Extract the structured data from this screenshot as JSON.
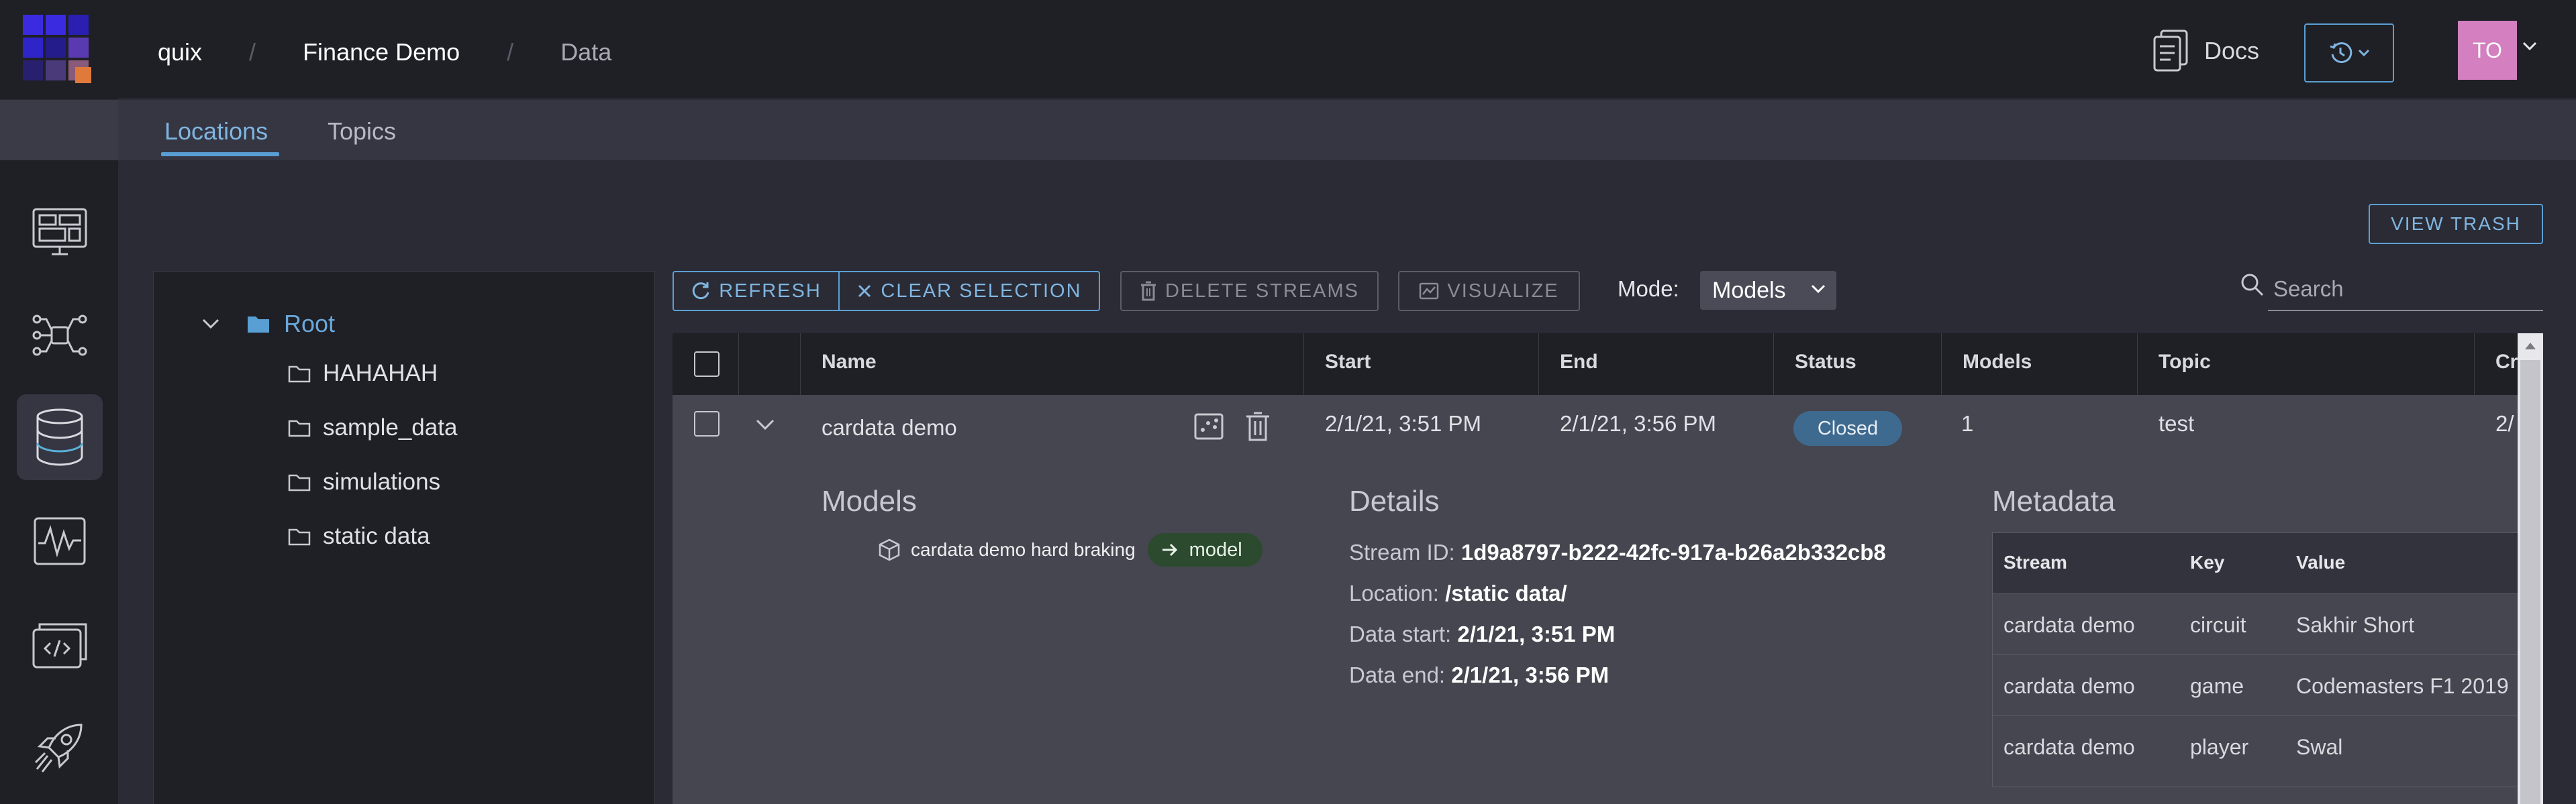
{
  "header": {
    "breadcrumb": [
      "quix",
      "Finance Demo",
      "Data"
    ],
    "docs_label": "Docs",
    "avatar_initials": "TO"
  },
  "subnav": {
    "tabs": [
      {
        "label": "Locations",
        "active": true
      },
      {
        "label": "Topics",
        "active": false
      }
    ]
  },
  "rail": {
    "items": [
      "dashboard-icon",
      "pipeline-icon",
      "database-icon",
      "waveform-icon",
      "code-icon",
      "rocket-icon"
    ],
    "active": "database-icon"
  },
  "actions": {
    "view_trash": "VIEW TRASH",
    "refresh": "REFRESH",
    "clear_selection": "CLEAR SELECTION",
    "delete_streams": "DELETE STREAMS",
    "visualize": "VISUALIZE",
    "mode_label": "Mode:",
    "mode_value": "Models",
    "search_placeholder": "Search"
  },
  "tree": {
    "root": "Root",
    "folders": [
      "HAHAHAH",
      "sample_data",
      "simulations",
      "static data"
    ]
  },
  "table": {
    "columns": [
      "Name",
      "Start",
      "End",
      "Status",
      "Models",
      "Topic",
      "Cr"
    ],
    "rows": [
      {
        "name": "cardata demo",
        "start": "2/1/21, 3:51 PM",
        "end": "2/1/21, 3:56 PM",
        "status": "Closed",
        "models": "1",
        "topic": "test",
        "created": "2/"
      }
    ]
  },
  "expanded": {
    "models_title": "Models",
    "model_name": "cardata demo hard braking",
    "model_badge": "model",
    "details_title": "Details",
    "details": [
      {
        "label": "Stream ID:",
        "value": "1d9a8797-b222-42fc-917a-b26a2b332cb8"
      },
      {
        "label": "Location:",
        "value": "/static data/"
      },
      {
        "label": "Data start:",
        "value": "2/1/21, 3:51 PM"
      },
      {
        "label": "Data end:",
        "value": "2/1/21, 3:56 PM"
      }
    ],
    "metadata_title": "Metadata",
    "metadata_columns": [
      "Stream",
      "Key",
      "Value"
    ],
    "metadata_rows": [
      [
        "cardata demo",
        "circuit",
        "Sakhir Short"
      ],
      [
        "cardata demo",
        "game",
        "Codemasters F1 2019"
      ],
      [
        "cardata demo",
        "player",
        "Swal"
      ]
    ]
  },
  "colors": {
    "accent": "#5a9fd4",
    "status_closed": "#3f6a90",
    "model_badge": "#2c4a2e",
    "avatar": "#d37fc0"
  }
}
